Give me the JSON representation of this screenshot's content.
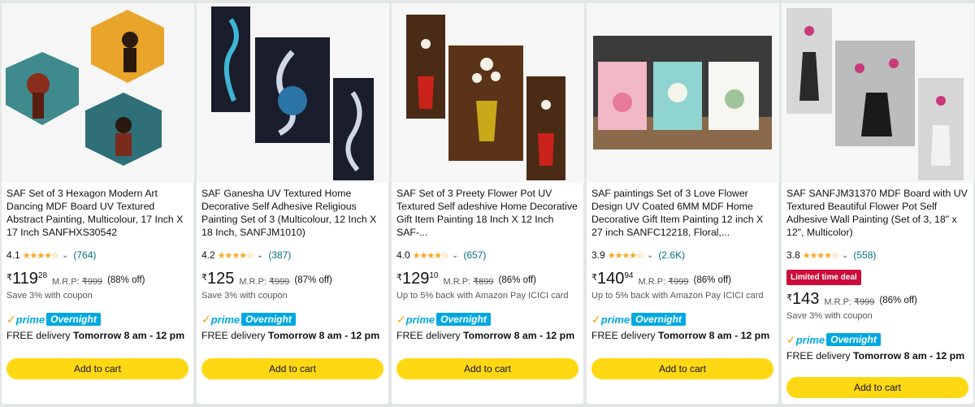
{
  "products": [
    {
      "title": "SAF Set of 3 Hexagon Modern Art Dancing MDF Board UV Textured Abstract Painting, Multicolour, 17 Inch X 17 Inch SANFHXS30542",
      "rating": "4.1",
      "reviews": "(764)",
      "currency": "₹",
      "price_whole": "119",
      "price_fraction": "28",
      "mrp_label": "M.R.P:",
      "mrp": "₹999",
      "discount": "(88% off)",
      "note": "Save 3% with coupon",
      "deal": "",
      "prime": "prime",
      "prime_badge": "Overnight",
      "delivery_prefix": "FREE delivery",
      "delivery_date": "Tomorrow 8 am - 12 pm",
      "button": "Add to cart"
    },
    {
      "title": "SAF Ganesha UV Textured Home Decorative Self Adhesive Religious Painting Set of 3 (Multicolour, 12 Inch X 18 Inch, SANFJM1010)",
      "rating": "4.2",
      "reviews": "(387)",
      "currency": "₹",
      "price_whole": "125",
      "price_fraction": "",
      "mrp_label": "M.R.P:",
      "mrp": "₹999",
      "discount": "(87% off)",
      "note": "Save 3% with coupon",
      "deal": "",
      "prime": "prime",
      "prime_badge": "Overnight",
      "delivery_prefix": "FREE delivery",
      "delivery_date": "Tomorrow 8 am - 12 pm",
      "button": "Add to cart"
    },
    {
      "title": "SAF Set of 3 Preety Flower Pot UV Textured Self adeshive Home Decorative Gift Item Painting 18 Inch X 12 Inch SAF-...",
      "rating": "4.0",
      "reviews": "(657)",
      "currency": "₹",
      "price_whole": "129",
      "price_fraction": "10",
      "mrp_label": "M.R.P:",
      "mrp": "₹899",
      "discount": "(86% off)",
      "note": "Up to 5% back with Amazon Pay ICICI card",
      "deal": "",
      "prime": "prime",
      "prime_badge": "Overnight",
      "delivery_prefix": "FREE delivery",
      "delivery_date": "Tomorrow 8 am - 12 pm",
      "button": "Add to cart"
    },
    {
      "title": "SAF paintings Set of 3 Love Flower Design UV Coated 6MM MDF Home Decorative Gift Item Painting 12 inch X 27 inch SANFC12218, Floral,...",
      "rating": "3.9",
      "reviews": "(2.6K)",
      "currency": "₹",
      "price_whole": "140",
      "price_fraction": "94",
      "mrp_label": "M.R.P:",
      "mrp": "₹999",
      "discount": "(86% off)",
      "note": "Up to 5% back with Amazon Pay ICICI card",
      "deal": "",
      "prime": "prime",
      "prime_badge": "Overnight",
      "delivery_prefix": "FREE delivery",
      "delivery_date": "Tomorrow 8 am - 12 pm",
      "button": "Add to cart"
    },
    {
      "title": "SAF SANFJM31370 MDF Board with UV Textured Beautiful Flower Pot Self Adhesive Wall Painting (Set of 3, 18\" x 12\", Multicolor)",
      "rating": "3.8",
      "reviews": "(558)",
      "currency": "₹",
      "price_whole": "143",
      "price_fraction": "",
      "mrp_label": "M.R.P:",
      "mrp": "₹999",
      "discount": "(86% off)",
      "note": "Save 3% with coupon",
      "deal": "Limited time deal",
      "prime": "prime",
      "prime_badge": "Overnight",
      "delivery_prefix": "FREE delivery",
      "delivery_date": "Tomorrow 8 am - 12 pm",
      "button": "Add to cart"
    }
  ],
  "colors": {
    "star": "#ffa41c",
    "link": "#007185",
    "button": "#ffd814",
    "prime_blue": "#00a8e1",
    "deal_red": "#cc0c39"
  }
}
